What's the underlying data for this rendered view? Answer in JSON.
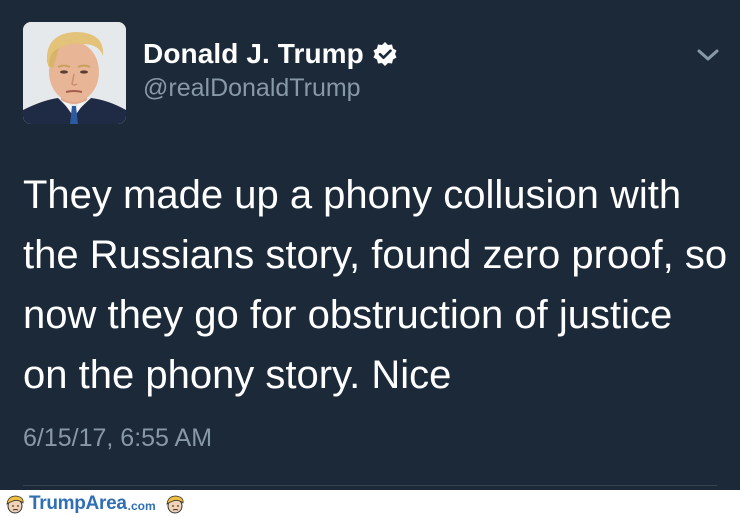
{
  "tweet": {
    "author_name": "Donald J. Trump",
    "author_handle": "@realDonaldTrump",
    "verified": true,
    "text_lines": [
      "They made up a phony collusion with",
      "the Russians story, found zero proof, so",
      "now they go for obstruction of justice",
      "on the phony story. Nice"
    ],
    "timestamp": "6/15/17, 6:55 AM"
  },
  "icons": {
    "verified": "verified-badge-icon",
    "menu": "chevron-down-icon",
    "avatar": "profile-photo"
  },
  "watermark": {
    "brand": "TrumpArea",
    "domain": ".com"
  },
  "colors": {
    "background": "#1c2938",
    "text": "#ffffff",
    "secondary_text": "#8899a6",
    "watermark": "#2f6fb4"
  }
}
